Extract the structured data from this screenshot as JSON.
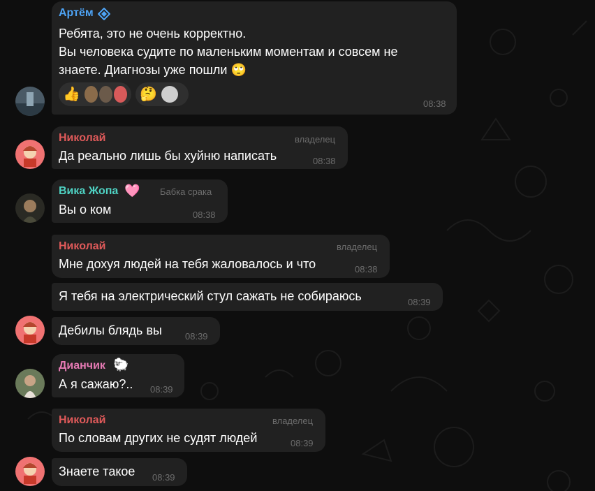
{
  "colors": {
    "background": "#0e0e0e",
    "bubble": "#212121",
    "artem_name": "#4ea4f6",
    "nikolai_name": "#e05a5a",
    "vika_name": "#4fd3c4",
    "dianchik_name": "#e67ab4",
    "muted": "#6c6c6c"
  },
  "messages": [
    {
      "sender": "Артём",
      "lines": [
        "Ребята, это не очень корректно.",
        "Вы человека судите по маленьким моментам и совсем не",
        "знаете. Диагнозы уже пошли 🙄"
      ],
      "time": "08:38",
      "reactions": [
        "👍",
        "🤔"
      ]
    },
    {
      "sender": "Николай",
      "badge": "владелец",
      "text": "Да реально лишь бы хуйню написать",
      "time": "08:38"
    },
    {
      "sender": "Вика Жопа",
      "sender_emoji": "🩷",
      "badge": "Бабка срака",
      "text": "Вы о ком",
      "time": "08:38"
    },
    {
      "sender": "Николай",
      "badge": "владелец",
      "text": "Мне дохуя людей на тебя жаловалось и что",
      "time": "08:38"
    },
    {
      "text": "Я тебя на электрический стул сажать не собираюсь",
      "time": "08:39"
    },
    {
      "text": "Дебилы блядь вы",
      "time": "08:39"
    },
    {
      "sender": "Дианчик",
      "sender_emoji": "🐑",
      "text": "А я сажаю?..",
      "time": "08:39"
    },
    {
      "sender": "Николай",
      "badge": "владелец",
      "text": "По словам других не судят людей",
      "time": "08:39"
    },
    {
      "text": "Знаете такое",
      "time": "08:39"
    }
  ]
}
